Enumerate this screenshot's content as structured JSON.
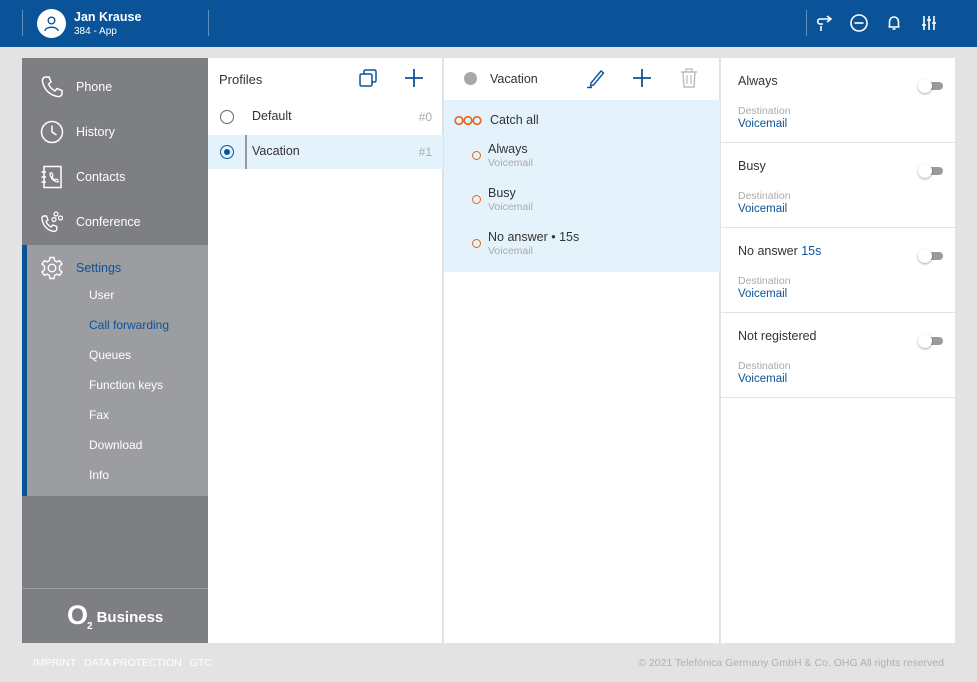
{
  "header": {
    "user_name": "Jan Krause",
    "user_extension": "384 - App",
    "icons": [
      "call-return-icon",
      "do-not-disturb-icon",
      "bell-icon",
      "sliders-icon"
    ]
  },
  "sidebar": {
    "items": [
      {
        "label": "Phone",
        "icon": "phone-icon"
      },
      {
        "label": "History",
        "icon": "clock-icon"
      },
      {
        "label": "Contacts",
        "icon": "contacts-icon"
      },
      {
        "label": "Conference",
        "icon": "conference-icon"
      },
      {
        "label": "Settings",
        "icon": "gear-icon",
        "active": true
      }
    ],
    "settings_subitems": [
      {
        "label": "User"
      },
      {
        "label": "Call forwarding",
        "active": true
      },
      {
        "label": "Queues"
      },
      {
        "label": "Function keys"
      },
      {
        "label": "Fax"
      },
      {
        "label": "Download"
      },
      {
        "label": "Info"
      }
    ],
    "logo": {
      "o2": "O",
      "sub": "2",
      "business": "Business"
    }
  },
  "profiles": {
    "title": "Profiles",
    "items": [
      {
        "name": "Default",
        "number": "#0",
        "selected": false
      },
      {
        "name": "Vacation",
        "number": "#1",
        "selected": true
      }
    ]
  },
  "rules": {
    "profile_title": "Vacation",
    "catch_all": "Catch all",
    "items": [
      {
        "title": "Always",
        "destination": "Voicemail"
      },
      {
        "title": "Busy",
        "destination": "Voicemail"
      },
      {
        "title": "No answer • 15s",
        "destination": "Voicemail"
      }
    ]
  },
  "details": {
    "cards": [
      {
        "title": "Always",
        "accent": "",
        "dest_label": "Destination",
        "dest_value": "Voicemail",
        "enabled": false
      },
      {
        "title": "Busy",
        "accent": "",
        "dest_label": "Destination",
        "dest_value": "Voicemail",
        "enabled": false
      },
      {
        "title": "No answer ",
        "accent": "15s",
        "dest_label": "Destination",
        "dest_value": "Voicemail",
        "enabled": false
      },
      {
        "title": "Not registered",
        "accent": "",
        "dest_label": "Destination",
        "dest_value": "Voicemail",
        "enabled": false
      }
    ]
  },
  "footer": {
    "links": [
      "IMPRINT",
      "DATA PROTECTION",
      "GTC"
    ],
    "copyright": "© 2021 Telefónica Germany GmbH & Co. OHG All rights reserved"
  },
  "colors": {
    "brand_blue": "#0b5398",
    "accent_orange": "#e8641e",
    "sidebar_gray": "#7d7f82",
    "selection_blue": "#e4f3fb"
  }
}
